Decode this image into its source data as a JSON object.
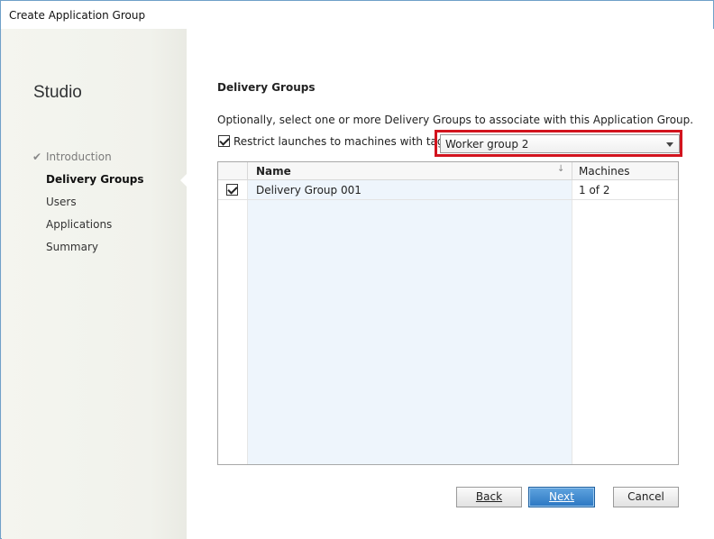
{
  "window": {
    "title": "Create Application Group"
  },
  "sidebar": {
    "brand": "Studio",
    "items": [
      {
        "label": "Introduction",
        "state": "done"
      },
      {
        "label": "Delivery Groups",
        "state": "current"
      },
      {
        "label": "Users",
        "state": "pending"
      },
      {
        "label": "Applications",
        "state": "pending"
      },
      {
        "label": "Summary",
        "state": "pending"
      }
    ],
    "done_icon": "check-icon"
  },
  "content": {
    "heading": "Delivery Groups",
    "description": "Optionally, select one or more Delivery Groups to associate with this Application Group.",
    "restrict_label": "Restrict launches to machines with tag:",
    "restrict_checked": true,
    "tag_selected": "Worker group 2",
    "highlight_color": "#d2141e"
  },
  "grid": {
    "columns": {
      "name": "Name",
      "machines": "Machines"
    },
    "sort_icon": "sort-down-arrow-icon",
    "rows": [
      {
        "checked": true,
        "name": "Delivery Group 001",
        "machines": "1 of 2"
      }
    ]
  },
  "buttons": {
    "back": "Back",
    "next": "Next",
    "cancel": "Cancel",
    "next_color": "#2b77c2"
  }
}
